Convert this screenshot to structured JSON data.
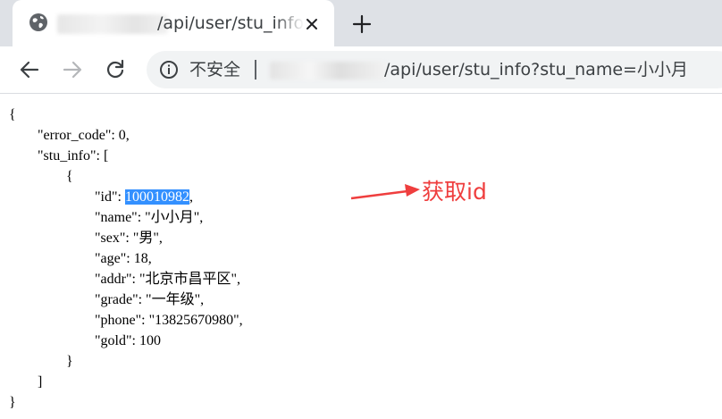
{
  "browser": {
    "tab": {
      "title": "/api/user/stu_info"
    },
    "address_bar": {
      "security_label": "不安全",
      "url": "/api/user/stu_info?stu_name=小小月"
    },
    "icons": {
      "tab_favicon": "globe-icon",
      "tab_close": "close-icon",
      "new_tab": "plus-icon",
      "back": "arrow-left-icon",
      "forward": "arrow-right-icon",
      "reload": "reload-icon",
      "info": "info-icon"
    }
  },
  "json_view": {
    "open_brace": "{",
    "error_code_line": "\"error_code\": 0,",
    "stu_info_line": "\"stu_info\": [",
    "item_open": "{",
    "id_key": "\"id\": ",
    "id_value": "100010982",
    "id_comma": ",",
    "name_line": "\"name\": \"小小月\",",
    "sex_line": "\"sex\": \"男\",",
    "age_line": "\"age\": 18,",
    "addr_line": "\"addr\": \"北京市昌平区\",",
    "grade_line": "\"grade\": \"一年级\",",
    "phone_line": "\"phone\": \"13825670980\",",
    "gold_line": "\"gold\": 100",
    "item_close": "}",
    "array_close": "]",
    "close_brace": "}"
  },
  "annotation": {
    "label": "获取id",
    "color": "#ef3e3e"
  },
  "colors": {
    "selection": "#3390ff",
    "tabstrip": "#dee1e6",
    "omnibox": "#f1f3f4"
  }
}
